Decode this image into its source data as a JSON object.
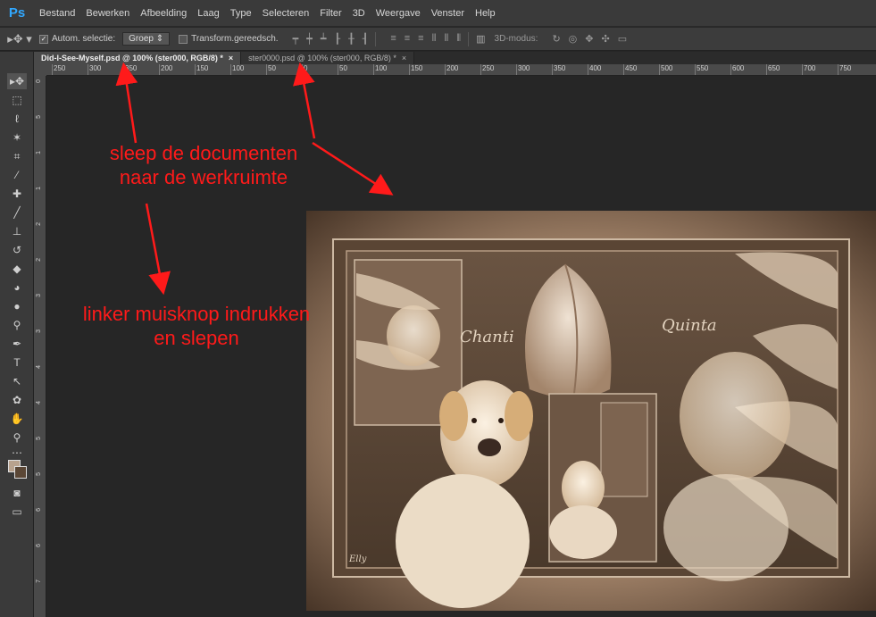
{
  "app": {
    "logo": "Ps"
  },
  "menu": [
    "Bestand",
    "Bewerken",
    "Afbeelding",
    "Laag",
    "Type",
    "Selecteren",
    "Filter",
    "3D",
    "Weergave",
    "Venster",
    "Help"
  ],
  "options_bar": {
    "tool_icon": "move-tool-icon",
    "auto_select_label": "Autom. selectie:",
    "auto_select_checked": true,
    "auto_select_value": "Groep",
    "transform_label": "Transform.gereedsch.",
    "mode_label": "3D-modus:"
  },
  "tabs": [
    {
      "title": "Did-I-See-Myself.psd @ 100% (ster000, RGB/8) *",
      "active": true
    },
    {
      "title": "ster0000.psd @ 100% (ster000, RGB/8) *",
      "active": false
    }
  ],
  "ruler": {
    "h_labels": [
      "250",
      "300",
      "350",
      "200",
      "150",
      "100",
      "50",
      "0",
      "50",
      "100",
      "150",
      "200",
      "250",
      "300",
      "350",
      "400",
      "450",
      "500",
      "550",
      "600",
      "650",
      "700",
      "750"
    ],
    "v_labels": [
      "0",
      "5",
      "1",
      "1",
      "2",
      "2",
      "3",
      "3",
      "4",
      "4",
      "5",
      "5",
      "6",
      "6",
      "7"
    ]
  },
  "annotations": {
    "drag_docs_line1": "sleep de documenten",
    "drag_docs_line2": "naar de werkruimte",
    "mouse_line1": "linker muisknop indrukken",
    "mouse_line2": "en slepen"
  },
  "artwork": {
    "text_left": "Chanti",
    "text_right": "Quinta",
    "signature": "Elly"
  },
  "colors": {
    "annotation": "#ff1a1a",
    "foreground": "#b8a28e",
    "background": "#5b4736"
  },
  "tools": [
    "move-tool-icon",
    "marquee-tool-icon",
    "lasso-tool-icon",
    "magic-wand-icon",
    "crop-tool-icon",
    "eyedropper-icon",
    "healing-brush-icon",
    "brush-tool-icon",
    "clone-stamp-icon",
    "history-brush-icon",
    "eraser-icon",
    "paint-bucket-icon",
    "blur-tool-icon",
    "dodge-tool-icon",
    "pen-tool-icon",
    "type-tool-icon",
    "path-selection-icon",
    "shape-tool-icon",
    "hand-tool-icon",
    "zoom-tool-icon",
    "more-tools-icon"
  ]
}
